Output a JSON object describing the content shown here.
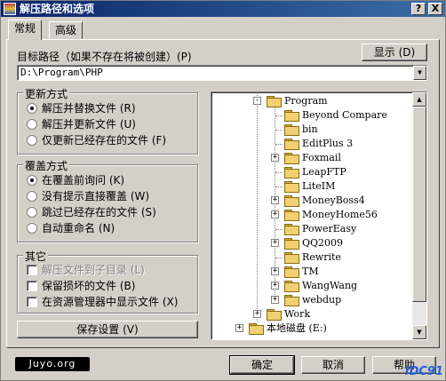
{
  "window": {
    "title": "解压路径和选项",
    "help_btn": "?",
    "close_btn": "X"
  },
  "tabs": [
    {
      "label": "常规",
      "active": true
    },
    {
      "label": "高级",
      "active": false
    }
  ],
  "target": {
    "label": "目标路径（如果不存在将被创建）(P)",
    "path": "D:\\Program\\PHP",
    "show_button": "显示 (D)"
  },
  "update_mode": {
    "title": "更新方式",
    "options": [
      {
        "label": "解压并替换文件 (R)",
        "selected": true
      },
      {
        "label": "解压并更新文件 (U)",
        "selected": false
      },
      {
        "label": "仅更新已经存在的文件 (F)",
        "selected": false
      }
    ]
  },
  "overwrite_mode": {
    "title": "覆盖方式",
    "options": [
      {
        "label": "在覆盖前询问 (K)",
        "selected": true
      },
      {
        "label": "没有提示直接覆盖 (W)",
        "selected": false
      },
      {
        "label": "跳过已经存在的文件 (S)",
        "selected": false
      },
      {
        "label": "自动重命名 (N)",
        "selected": false
      }
    ]
  },
  "misc": {
    "title": "其它",
    "options": [
      {
        "label": "解压文件到子目录 (L)",
        "checked": false,
        "disabled": true
      },
      {
        "label": "保留损坏的文件 (B)",
        "checked": false,
        "disabled": false
      },
      {
        "label": "在资源管理器中显示文件 (X)",
        "checked": false,
        "disabled": false
      }
    ]
  },
  "save_settings": "保存设置 (V)",
  "tree": {
    "items": [
      {
        "label": "Program",
        "expander": "-"
      },
      {
        "label": "Beyond Compare",
        "expander": ""
      },
      {
        "label": "bin",
        "expander": ""
      },
      {
        "label": "EditPlus 3",
        "expander": ""
      },
      {
        "label": "Foxmail",
        "expander": "+"
      },
      {
        "label": "LeapFTP",
        "expander": ""
      },
      {
        "label": "LiteIM",
        "expander": ""
      },
      {
        "label": "MoneyBoss4",
        "expander": "+"
      },
      {
        "label": "MoneyHome56",
        "expander": "+"
      },
      {
        "label": "PowerEasy",
        "expander": ""
      },
      {
        "label": "QQ2009",
        "expander": "+"
      },
      {
        "label": "Rewrite",
        "expander": ""
      },
      {
        "label": "TM",
        "expander": "+"
      },
      {
        "label": "WangWang",
        "expander": "+"
      },
      {
        "label": "webdup",
        "expander": "+"
      },
      {
        "label": "Work",
        "expander": "+"
      },
      {
        "label": "本地磁盘 (E:)",
        "expander": "+"
      }
    ]
  },
  "footer": {
    "logo": "Juyo.org",
    "ok": "确定",
    "cancel": "取消",
    "help": "帮助",
    "watermark": "IDC91"
  }
}
